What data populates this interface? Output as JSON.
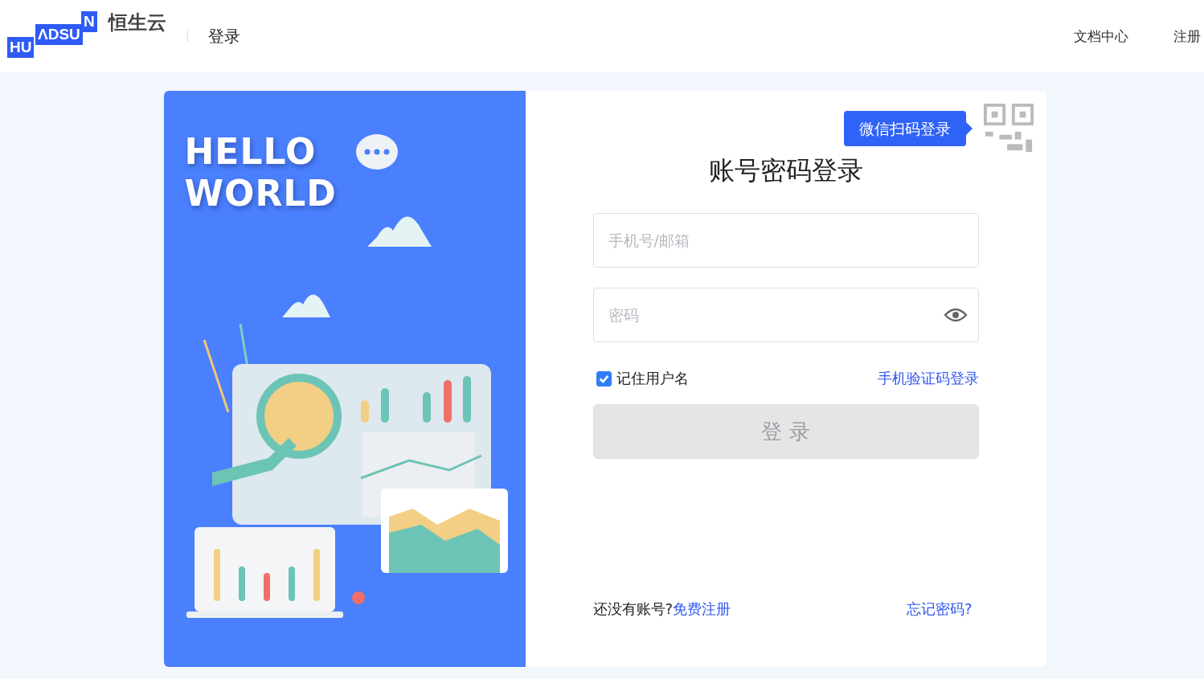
{
  "header": {
    "logo": {
      "parts": [
        "HU",
        "ΛDSU",
        "N"
      ],
      "name": "恒生云"
    },
    "page_title": "登录",
    "nav": [
      "文档中心",
      "注册"
    ]
  },
  "banner": {
    "lines": [
      "HELLO",
      "WORLD"
    ]
  },
  "login": {
    "qr_tip": "微信扫码登录",
    "title": "账号密码登录",
    "fields": [
      {
        "kind": "text",
        "placeholder": "手机号/邮箱"
      },
      {
        "kind": "password",
        "placeholder": "密码"
      }
    ],
    "remember": {
      "label": "记住用户名",
      "checked": true
    },
    "sms_link": "手机验证码登录",
    "submit": {
      "label": "登 录",
      "disabled": true
    },
    "signup_prompt": "还没有账号?",
    "signup_link": "免费注册",
    "forgot_link": "忘记密码?"
  }
}
